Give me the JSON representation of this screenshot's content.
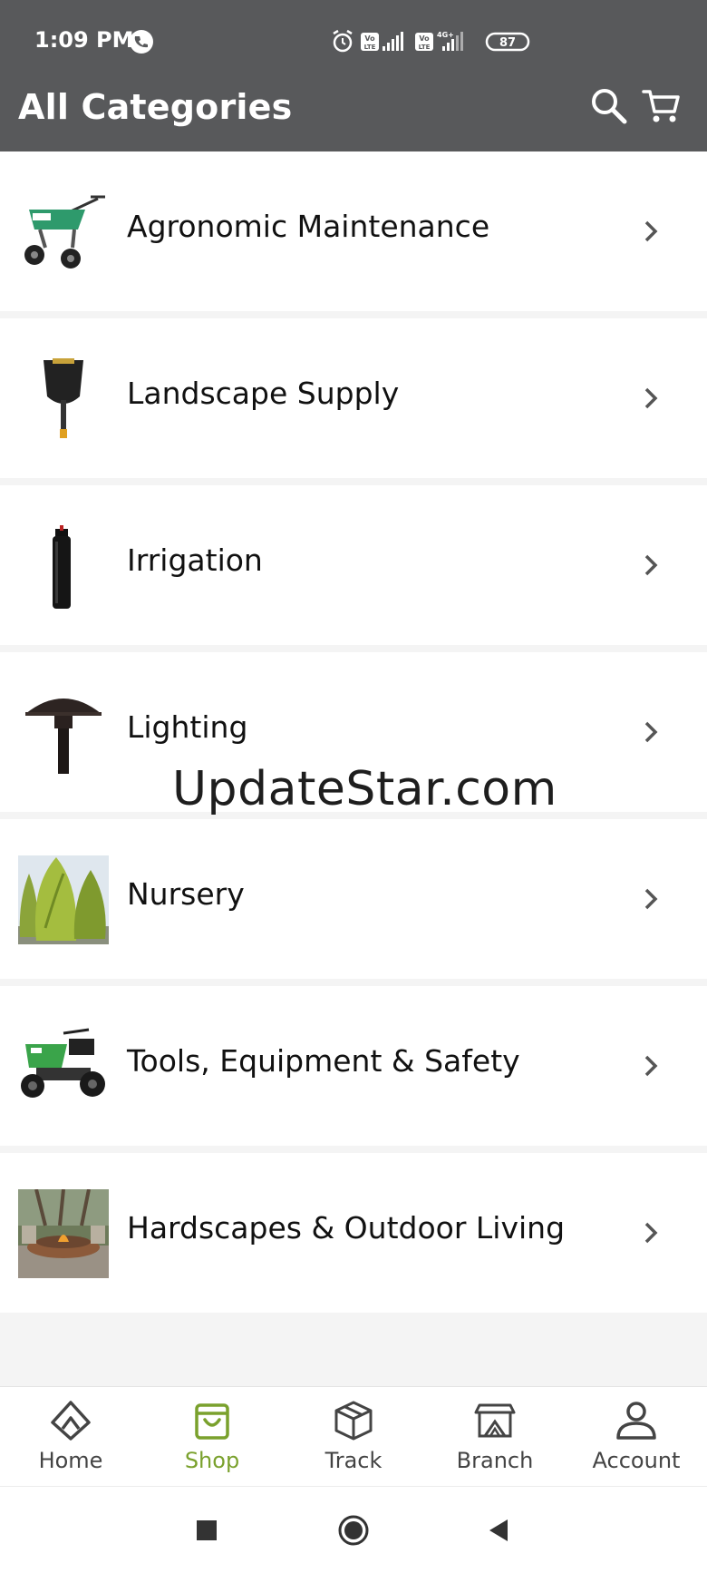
{
  "status_bar": {
    "time": "1:09 PM",
    "battery": "87",
    "network_1": "Vo LTE",
    "network_2": "Vo LTE",
    "network_type": "4G+"
  },
  "app_bar": {
    "title": "All Categories",
    "search_icon": "search-icon",
    "cart_icon": "cart-icon"
  },
  "categories": [
    {
      "label": "Agronomic Maintenance",
      "image": "spreader"
    },
    {
      "label": "Landscape Supply",
      "image": "shovel"
    },
    {
      "label": "Irrigation",
      "image": "sprinkler-head"
    },
    {
      "label": "Lighting",
      "image": "path-light"
    },
    {
      "label": "Nursery",
      "image": "arborvitae-photo"
    },
    {
      "label": "Tools, Equipment & Safety",
      "image": "ride-on-spreader"
    },
    {
      "label": "Hardscapes & Outdoor Living",
      "image": "fire-pit-photo"
    }
  ],
  "watermark": "UpdateStar.com",
  "bottom_nav": {
    "active": "Shop",
    "active_color": "#7aa12d",
    "items": [
      {
        "label": "Home",
        "icon": "home-icon"
      },
      {
        "label": "Shop",
        "icon": "shopping-bag-icon"
      },
      {
        "label": "Track",
        "icon": "box-icon"
      },
      {
        "label": "Branch",
        "icon": "branch-store-icon"
      },
      {
        "label": "Account",
        "icon": "user-icon"
      }
    ]
  },
  "colors": {
    "app_bar": "#58595b",
    "accent": "#7aa12d",
    "background": "#f4f4f4"
  }
}
